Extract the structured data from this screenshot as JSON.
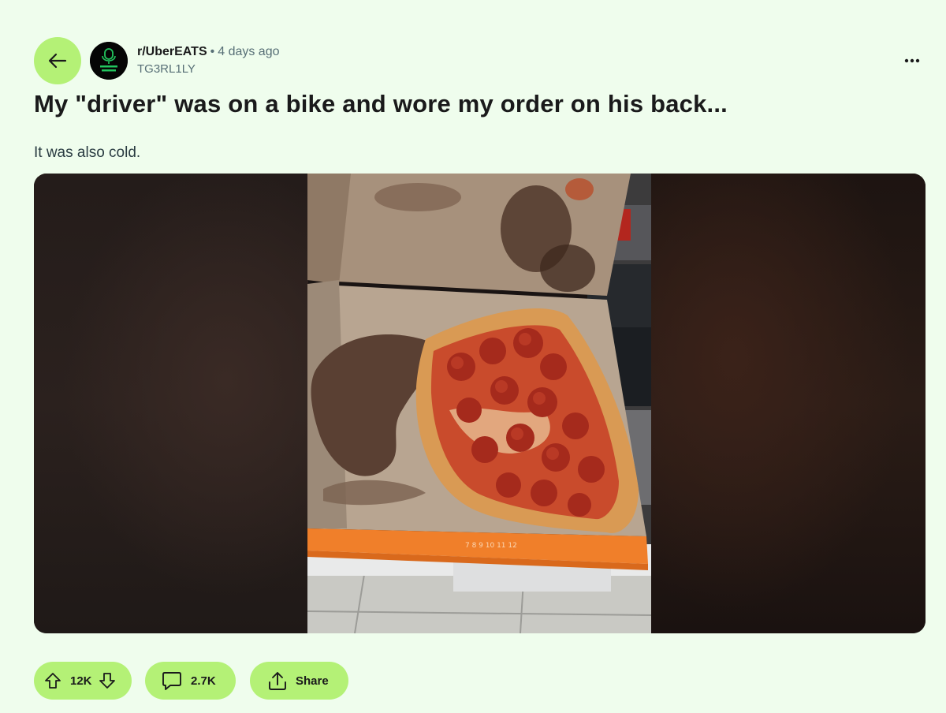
{
  "post": {
    "subreddit": "r/UberEATS",
    "separator": "•",
    "time_ago": "4 days ago",
    "author": "TG3RL1LY",
    "title": "My \"driver\" was on a bike and wore my order on his back...",
    "body": "It was also cold."
  },
  "actions": {
    "vote_count": "12K",
    "comment_count": "2.7K",
    "share_label": "Share"
  },
  "icons": {
    "back": "arrow-left-icon",
    "more": "more-horizontal-icon",
    "upvote": "upvote-arrow-icon",
    "downvote": "downvote-arrow-icon",
    "comment": "comment-bubble-icon",
    "share": "share-icon"
  },
  "colors": {
    "background": "#effded",
    "accent_pill": "#b4f176",
    "avatar_logo_green": "#22c55e"
  }
}
